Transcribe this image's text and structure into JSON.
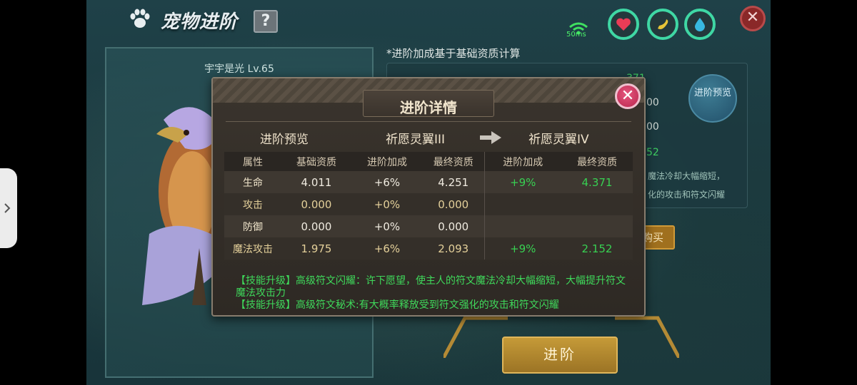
{
  "header": {
    "title": "宠物进阶",
    "help_label": "?",
    "ping": "50ms"
  },
  "pet_panel": {
    "name_level": "宇宇是光 Lv.65"
  },
  "background": {
    "note": "*进阶加成基于基础资质计算",
    "preview_button": "进阶预览",
    "partial_values": [
      "371",
      "00",
      "00",
      "52"
    ],
    "partial_texts": [
      "魔法冷却大幅缩短，",
      "化的攻击和符文闪耀"
    ],
    "buy_label": "购买",
    "advance_label": "进阶"
  },
  "dialog": {
    "title": "进阶详情",
    "preview_label": "进阶预览",
    "from_stage": "祈愿灵翼III",
    "to_stage": "祈愿灵翼IV",
    "columns": [
      "属性",
      "基础资质",
      "进阶加成",
      "最终资质",
      "进阶加成",
      "最终资质"
    ],
    "rows": [
      {
        "attr": "生命",
        "base": "4.011",
        "bonus": "+6%",
        "final": "4.251",
        "next_bonus": "+9%",
        "next_final": "4.371"
      },
      {
        "attr": "攻击",
        "base": "0.000",
        "bonus": "+0%",
        "final": "0.000",
        "next_bonus": "",
        "next_final": ""
      },
      {
        "attr": "防御",
        "base": "0.000",
        "bonus": "+0%",
        "final": "0.000",
        "next_bonus": "",
        "next_final": ""
      },
      {
        "attr": "魔法攻击",
        "base": "1.975",
        "bonus": "+6%",
        "final": "2.093",
        "next_bonus": "+9%",
        "next_final": "2.152"
      }
    ],
    "skills": [
      "【技能升级】高级符文闪耀：许下愿望，使主人的符文魔法冷却大幅缩短，大幅提升符文魔法攻击力",
      "【技能升级】高级符文秘术:有大概率释放受到符文强化的攻击和符文闪耀"
    ]
  },
  "colors": {
    "bonus_green": "#38d052",
    "accent_teal": "#3fd7a4",
    "close_pink": "#d83a64"
  }
}
